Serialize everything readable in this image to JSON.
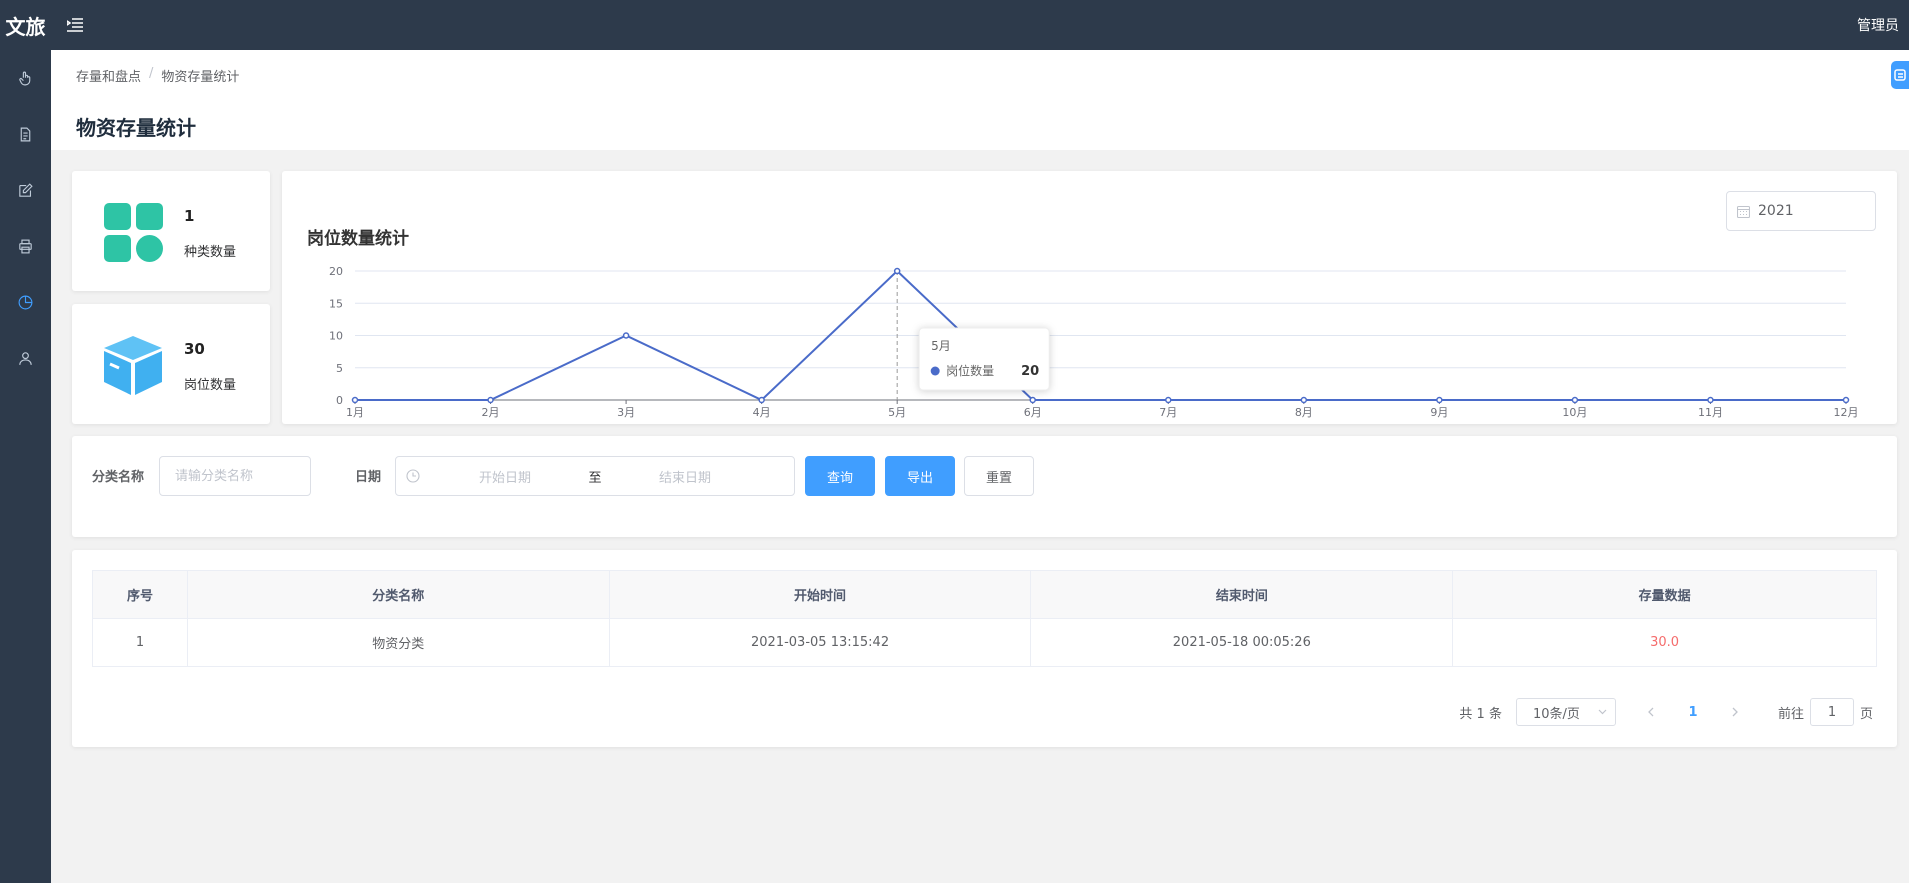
{
  "logo": "文旅",
  "user": {
    "name": "管理员"
  },
  "breadcrumb": [
    "存量和盘点",
    "物资存量统计"
  ],
  "page_title": "物资存量统计",
  "stats": [
    {
      "value": "1",
      "label": "种类数量"
    },
    {
      "value": "30",
      "label": "岗位数量"
    }
  ],
  "year_picker": {
    "value": "2021"
  },
  "chart_data": {
    "type": "line",
    "title": "岗位数量统计",
    "categories": [
      "1月",
      "2月",
      "3月",
      "4月",
      "5月",
      "6月",
      "7月",
      "8月",
      "9月",
      "10月",
      "11月",
      "12月"
    ],
    "series": [
      {
        "name": "岗位数量",
        "values": [
          0,
          0,
          10,
          0,
          20,
          0,
          0,
          0,
          0,
          0,
          0,
          0
        ]
      }
    ],
    "ylim": [
      0,
      20
    ],
    "yticks": [
      0,
      5,
      10,
      15,
      20
    ],
    "grid": true,
    "color": "#4a6bc9",
    "tooltip": {
      "category": "5月",
      "series": "岗位数量",
      "value": "20"
    }
  },
  "filters": {
    "category_label": "分类名称",
    "category_placeholder": "请输分类名称",
    "date_label": "日期",
    "date_start_placeholder": "开始日期",
    "date_separator": "至",
    "date_end_placeholder": "结束日期",
    "query_button": "查询",
    "export_button": "导出",
    "reset_button": "重置"
  },
  "table": {
    "columns": [
      "序号",
      "分类名称",
      "开始时间",
      "结束时间",
      "存量数据"
    ],
    "rows": [
      [
        "1",
        "物资分类",
        "2021-03-05 13:15:42",
        "2021-05-18 00:05:26",
        "30.0"
      ]
    ]
  },
  "pagination": {
    "total_text": "共 1 条",
    "page_size": "10条/页",
    "current_page": "1",
    "goto_prefix": "前往",
    "goto_value": "1",
    "goto_suffix": "页"
  },
  "colors": {
    "sidebar": "#2d3a4b",
    "primary": "#409eff",
    "stat_teal": "#2ec4a5",
    "stat_blue": "#40b0f0",
    "danger": "#f56c6c"
  }
}
